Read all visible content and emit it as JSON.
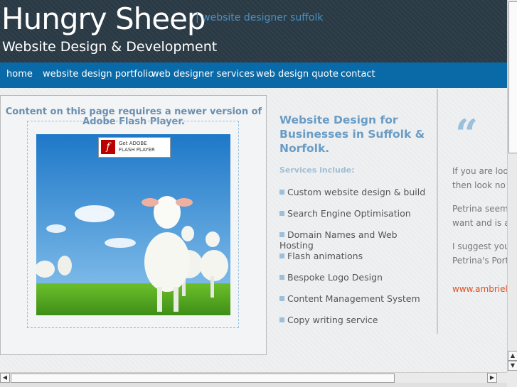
{
  "header": {
    "logo_title": "Hungry Sheep",
    "logo_subtitle": "Website Design & Development",
    "tagline": "| website designer suffolk"
  },
  "nav": {
    "items": [
      {
        "label": "home"
      },
      {
        "label": "website design portfolio"
      },
      {
        "label": "web designer services"
      },
      {
        "label": "web design quote"
      },
      {
        "label": "contact"
      }
    ]
  },
  "flash": {
    "message": "Content on this page requires a newer version of Adobe Flash Player.",
    "get_flash_line1": "Get ADOBE",
    "get_flash_line2": "FLASH PLAYER"
  },
  "services": {
    "title": "Website Design for Businesses in Suffolk & Norfolk.",
    "include_label": "Services include:",
    "items": [
      "Custom website design & build",
      "Search Engine Optimisation",
      "Domain Names and Web Hosting",
      "Flash animations",
      "Bespoke Logo Design",
      "Content Management System",
      "Copy writing service"
    ]
  },
  "testimonial": {
    "quote_mark": "“",
    "line1": "If you are loo",
    "line2": "then look no f",
    "line3": "Petrina seem",
    "line4": "want and is a",
    "line5": "I suggest you",
    "line6": "Petrina's Port",
    "link": "www.ambrielle"
  },
  "colors": {
    "header_bg": "#2a3a45",
    "nav_bg": "#0a6aa8",
    "accent": "#6a9cc4",
    "link": "#e05020"
  }
}
